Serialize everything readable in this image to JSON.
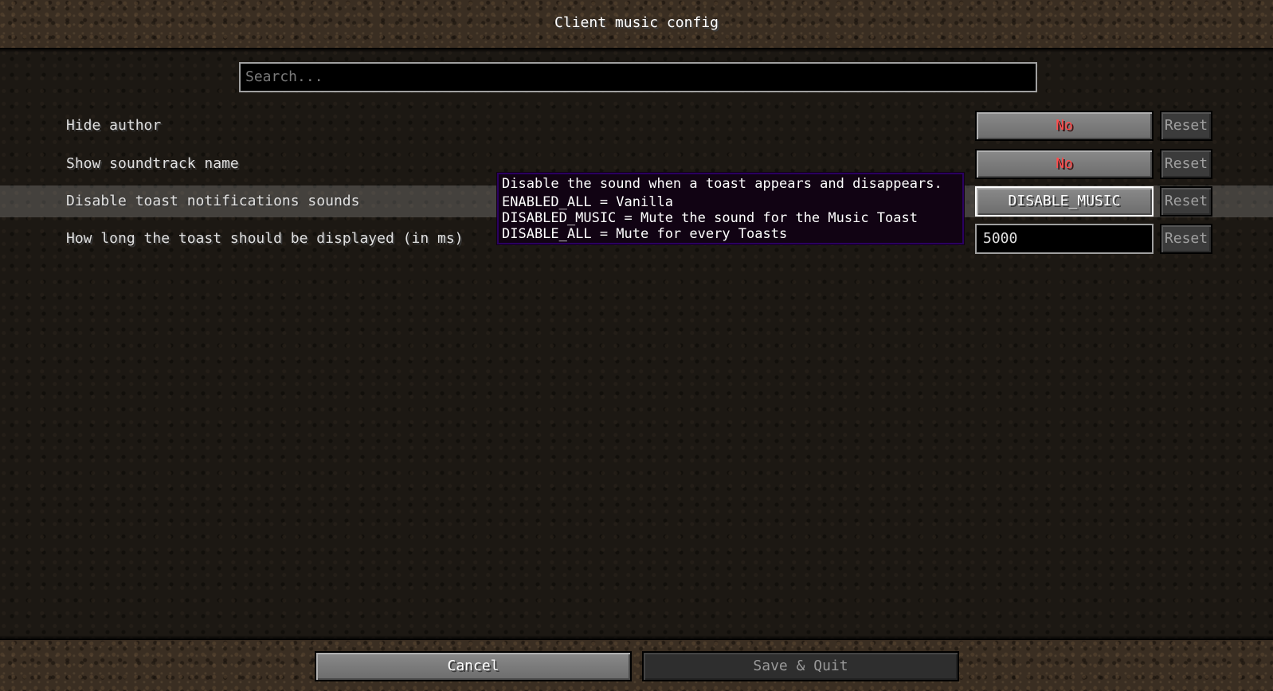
{
  "screen": {
    "title": "Client music config"
  },
  "search": {
    "placeholder": "Search..."
  },
  "options": [
    {
      "label": "Hide author",
      "value": "No",
      "reset": "Reset"
    },
    {
      "label": "Show soundtrack name",
      "value": "No",
      "reset": "Reset"
    },
    {
      "label": "Disable toast notifications sounds",
      "value": "DISABLE_MUSIC",
      "reset": "Reset"
    },
    {
      "label": "How long the toast should be displayed (in ms)",
      "value": "5000",
      "reset": "Reset"
    }
  ],
  "tooltip": {
    "lines": [
      "Disable the sound when a toast appears and disappears.",
      "ENABLED_ALL = Vanilla",
      "DISABLED_MUSIC = Mute the sound for the Music Toast",
      "DISABLE_ALL = Mute for every Toasts"
    ]
  },
  "footer": {
    "cancel_label": "Cancel",
    "save_label": "Save & Quit"
  },
  "colors": {
    "off_value": "#ff4c4c",
    "tooltip_bg": "#110313",
    "tooltip_border": "#2a0060"
  }
}
